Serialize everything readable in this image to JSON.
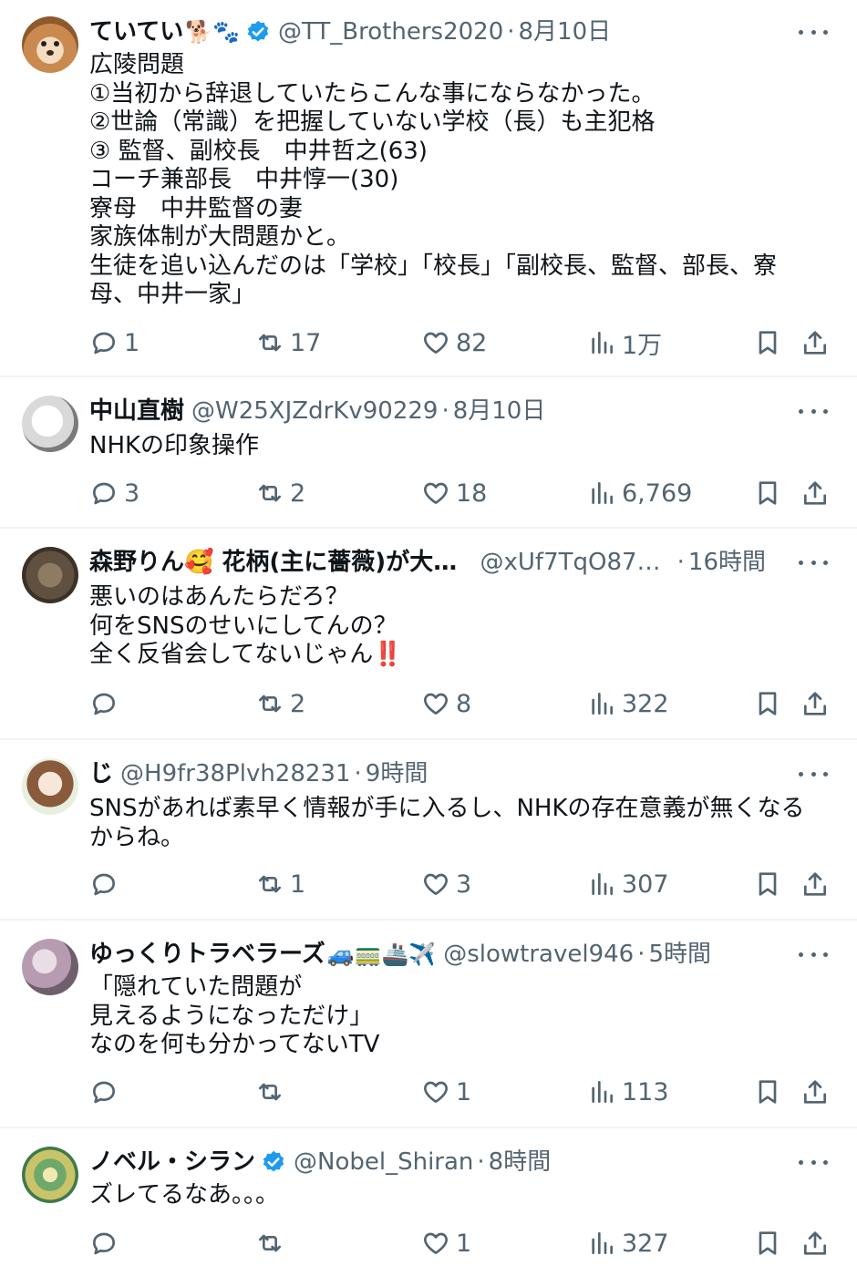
{
  "tweets": [
    {
      "name": "ていてい",
      "name_emoji": "🐕🐾",
      "verified": true,
      "handle": "@TT_Brothers2020",
      "time": "8月10日",
      "text": "広陵問題\n①当初から辞退していたらこんな事にならなかった。\n②世論（常識）を把握していない学校（長）も主犯格\n③ 監督、副校長　中井哲之(63)\nコーチ兼部長　中井惇一(30)\n寮母　中井監督の妻\n家族体制が大問題かと。\n生徒を追い込んだのは「学校」「校長」「副校長、監督、部長、寮母、中井一家」",
      "replies": "1",
      "retweets": "17",
      "likes": "82",
      "views": "1万"
    },
    {
      "name": "中山直樹",
      "name_emoji": "",
      "verified": false,
      "handle": "@W25XJZdrKv90229",
      "time": "8月10日",
      "text": "NHKの印象操作",
      "replies": "3",
      "retweets": "2",
      "likes": "18",
      "views": "6,769"
    },
    {
      "name": "森野りん🥰 花柄(主に薔薇)が大...",
      "name_emoji": "",
      "verified": false,
      "handle": "@xUf7TqO87q...",
      "time": "16時間",
      "text": "悪いのはあんたらだろ？\n何をSNSのせいにしてんの？\n全く反省会してないじゃん‼️",
      "replies": "",
      "retweets": "2",
      "likes": "8",
      "views": "322"
    },
    {
      "name": "じ",
      "name_emoji": "",
      "verified": false,
      "handle": "@H9fr38Plvh28231",
      "time": "9時間",
      "text": "SNSがあれば素早く情報が手に入るし、NHKの存在意義が無くなるからね。",
      "replies": "",
      "retweets": "1",
      "likes": "3",
      "views": "307"
    },
    {
      "name": "ゆっくりトラベラーズ",
      "name_emoji": "🚙🚃🚢✈️",
      "verified": false,
      "handle": "@slowtravel946",
      "time": "5時間",
      "text": "「隠れていた問題が\n見えるようになっただけ」\nなのを何も分かってないTV",
      "replies": "",
      "retweets": "",
      "likes": "1",
      "views": "113"
    },
    {
      "name": "ノベル・シラン",
      "name_emoji": "",
      "verified": true,
      "handle": "@Nobel_Shiran",
      "time": "8時間",
      "text": "ズレてるなあ。。。",
      "replies": "",
      "retweets": "",
      "likes": "1",
      "views": "327"
    }
  ],
  "icons": {
    "reply": "reply-icon",
    "retweet": "retweet-icon",
    "like": "heart-icon",
    "views": "views-chart-icon",
    "bookmark": "bookmark-icon",
    "share": "share-icon",
    "more": "more-dots-icon",
    "verified": "verified-badge-icon"
  },
  "colors": {
    "text_primary": "#0f1419",
    "text_secondary": "#536471",
    "verified_blue": "#1d9bf0",
    "divider": "#eff3f4"
  }
}
